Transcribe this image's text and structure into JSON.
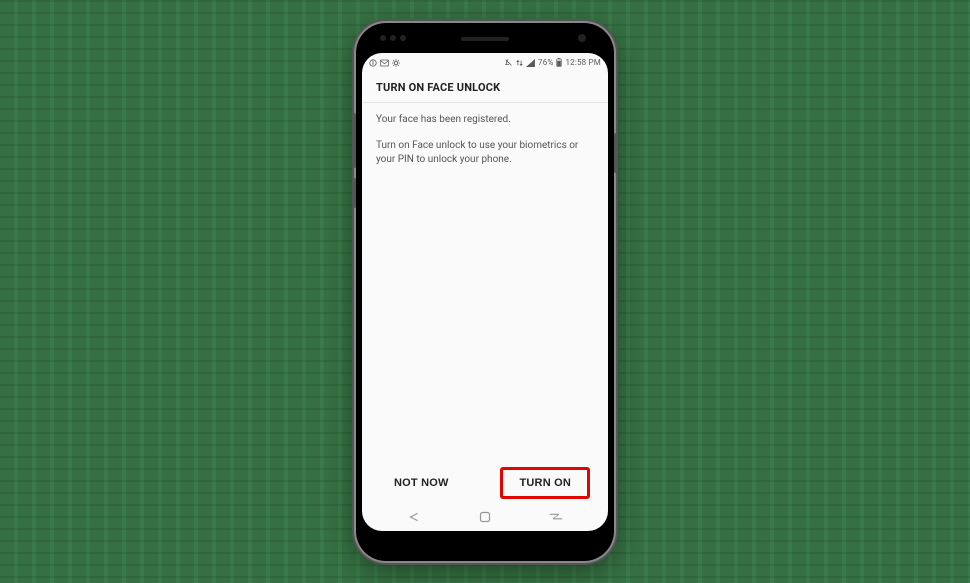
{
  "status_bar": {
    "time": "12:58 PM",
    "battery_text": "76%",
    "left_icons": [
      "info-icon",
      "mail-icon",
      "settings-icon"
    ],
    "right_icons": [
      "mute-icon",
      "data-icon",
      "signal-icon",
      "battery-icon"
    ]
  },
  "header": {
    "title": "TURN ON FACE UNLOCK"
  },
  "body": {
    "line1": "Your face has been registered.",
    "line2": "Turn on Face unlock to use your biometrics or your PIN to unlock your phone."
  },
  "footer": {
    "not_now_label": "NOT NOW",
    "turn_on_label": "TURN ON"
  },
  "nav": {
    "back": "back-icon",
    "home": "home-icon",
    "recents": "recents-icon"
  },
  "annotation": {
    "highlight_target": "turn-on-button",
    "highlight_color": "#e10600"
  }
}
